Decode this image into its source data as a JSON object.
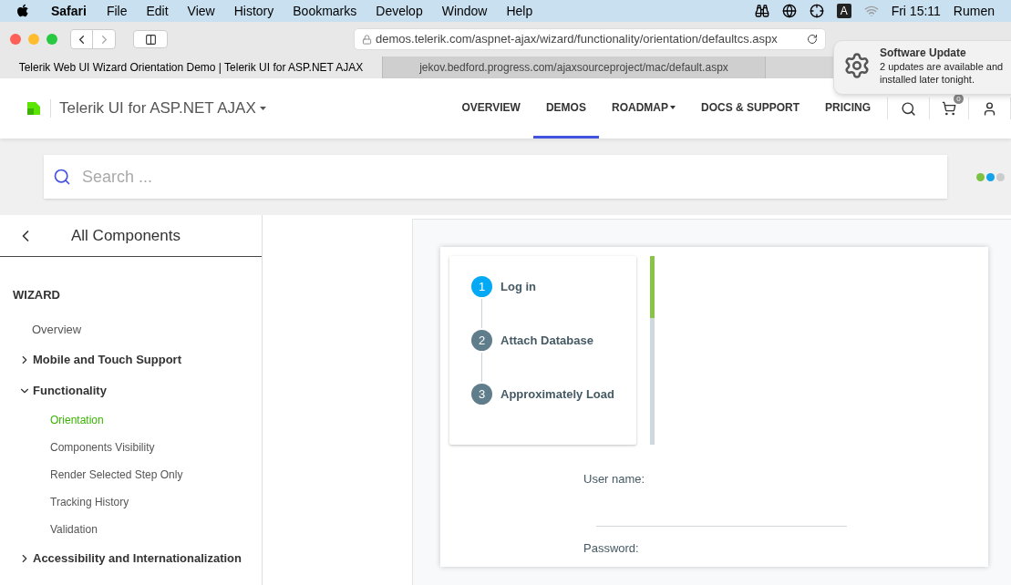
{
  "menu_bar": {
    "app": "Safari",
    "items": [
      "File",
      "Edit",
      "View",
      "History",
      "Bookmarks",
      "Develop",
      "Window",
      "Help"
    ],
    "clock": "Fri 15:11",
    "user": "Rumen",
    "input_badge": "A"
  },
  "address_bar": {
    "url": "demos.telerik.com/aspnet-ajax/wizard/functionality/orientation/defaultcs.aspx"
  },
  "browser_tabs": [
    {
      "title": "Telerik Web UI Wizard Orientation Demo | Telerik UI for ASP.NET AJAX",
      "selected": true
    },
    {
      "title": "jekov.bedford.progress.com/ajaxsourceproject/mac/default.aspx",
      "selected": false
    }
  ],
  "notification": {
    "title": "Software Update",
    "body_shown": "2 updates are available and",
    "body_line2": "installed later tonight."
  },
  "site_header": {
    "product": "Telerik UI for ASP.NET AJAX",
    "nav": [
      {
        "label": "OVERVIEW",
        "selected": false,
        "dropdown": false
      },
      {
        "label": "DEMOS",
        "selected": true,
        "dropdown": false
      },
      {
        "label": "ROADMAP",
        "selected": false,
        "dropdown": true
      },
      {
        "label": "DOCS & SUPPORT",
        "selected": false,
        "dropdown": false
      },
      {
        "label": "PRICING",
        "selected": false,
        "dropdown": false
      }
    ],
    "cart_count": "0"
  },
  "search": {
    "placeholder": "Search ..."
  },
  "sidebar": {
    "title": "All Components",
    "section": "WIZARD",
    "items": [
      {
        "label": "Overview",
        "kind": "link",
        "selected": false
      },
      {
        "label": "Mobile and Touch Support",
        "kind": "group",
        "expanded": false
      },
      {
        "label": "Functionality",
        "kind": "group",
        "expanded": true,
        "children": [
          {
            "label": "Orientation",
            "selected": true
          },
          {
            "label": "Components Visibility",
            "selected": false
          },
          {
            "label": "Render Selected Step Only",
            "selected": false
          },
          {
            "label": "Tracking History",
            "selected": false
          },
          {
            "label": "Validation",
            "selected": false
          }
        ]
      },
      {
        "label": "Accessibility and Internationalization",
        "kind": "group",
        "expanded": false
      }
    ]
  },
  "wizard": {
    "steps": [
      {
        "number": "1",
        "label": "Log in",
        "selected": true
      },
      {
        "number": "2",
        "label": "Attach Database",
        "selected": false
      },
      {
        "number": "3",
        "label": "Approximately Load",
        "selected": false
      }
    ],
    "progress": {
      "level": 0.33
    },
    "fields": [
      {
        "label": "User name:"
      },
      {
        "label": "Password:"
      }
    ]
  }
}
